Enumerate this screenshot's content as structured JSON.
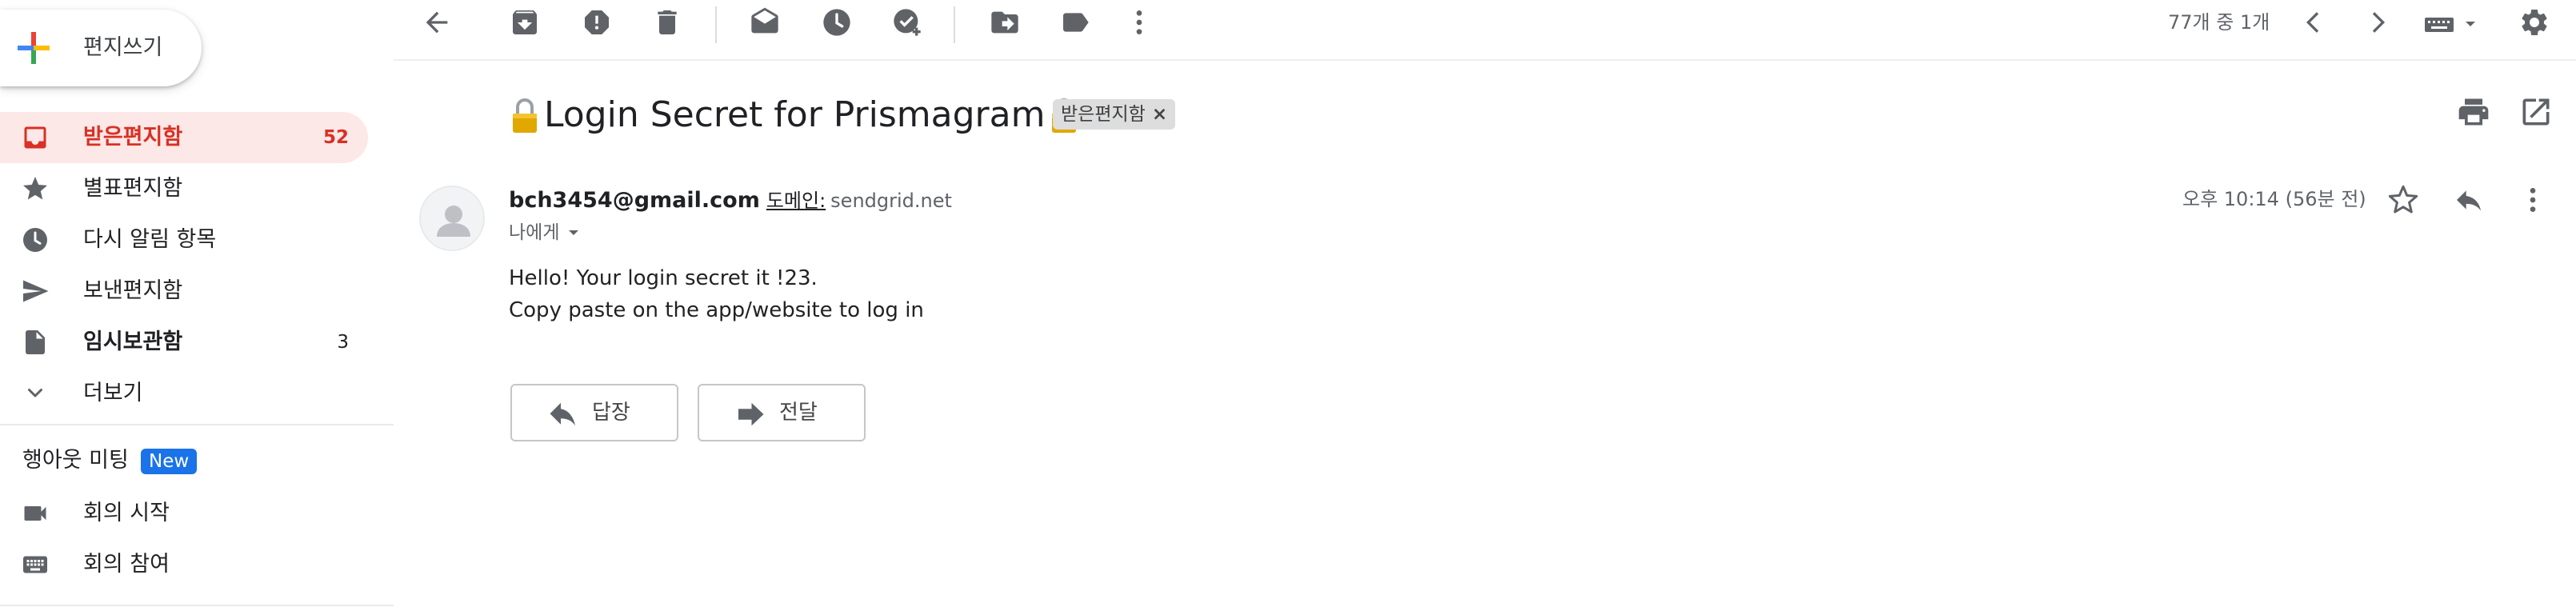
{
  "sidebar": {
    "compose_label": "편지쓰기",
    "items": [
      {
        "label": "받은편지함",
        "count": "52"
      },
      {
        "label": "별표편지함",
        "count": ""
      },
      {
        "label": "다시 알림 항목",
        "count": ""
      },
      {
        "label": "보낸편지함",
        "count": ""
      },
      {
        "label": "임시보관함",
        "count": "3"
      },
      {
        "label": "더보기",
        "count": ""
      }
    ],
    "meet": {
      "header": "행아웃 미팅",
      "badge": "New",
      "items": [
        {
          "label": "회의 시작"
        },
        {
          "label": "회의 참여"
        }
      ]
    }
  },
  "toolbar": {
    "page_count": "77개 중 1개"
  },
  "message": {
    "subject": "Login Secret for Prismagram",
    "label_chip": "받은편지함",
    "label_chip_close": "×",
    "sender_email": "bch3454@gmail.com",
    "domain_label": "도메인:",
    "domain_value": "sendgrid.net",
    "recipient": "나에게",
    "time": "오후 10:14 (56분 전)",
    "body": [
      "Hello! Your login secret it !23.",
      "Copy paste on the app/website to log in"
    ],
    "reply_label": "답장",
    "forward_label": "전달"
  },
  "colors": {
    "accent_red": "#d93025",
    "active_nav_bg": "#fce8e6",
    "new_badge": "#1a73e8",
    "icon_gray": "#5f6368"
  }
}
